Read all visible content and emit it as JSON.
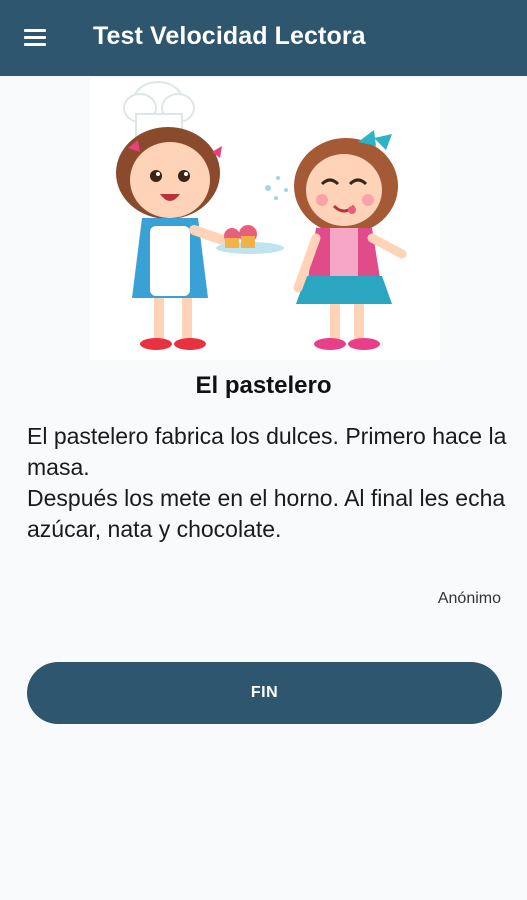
{
  "appbar": {
    "title": "Test Velocidad Lectora",
    "menu_icon": "hamburger-menu-icon",
    "color": "#2f566f"
  },
  "story": {
    "title": "El pastelero",
    "lines": [
      "El pastelero fabrica los dulces. Primero hace la masa.",
      "Después los mete en el horno. Al final les echa azúcar, nata y chocolate."
    ],
    "author": "Anónimo"
  },
  "actions": {
    "fin_label": "FIN"
  }
}
